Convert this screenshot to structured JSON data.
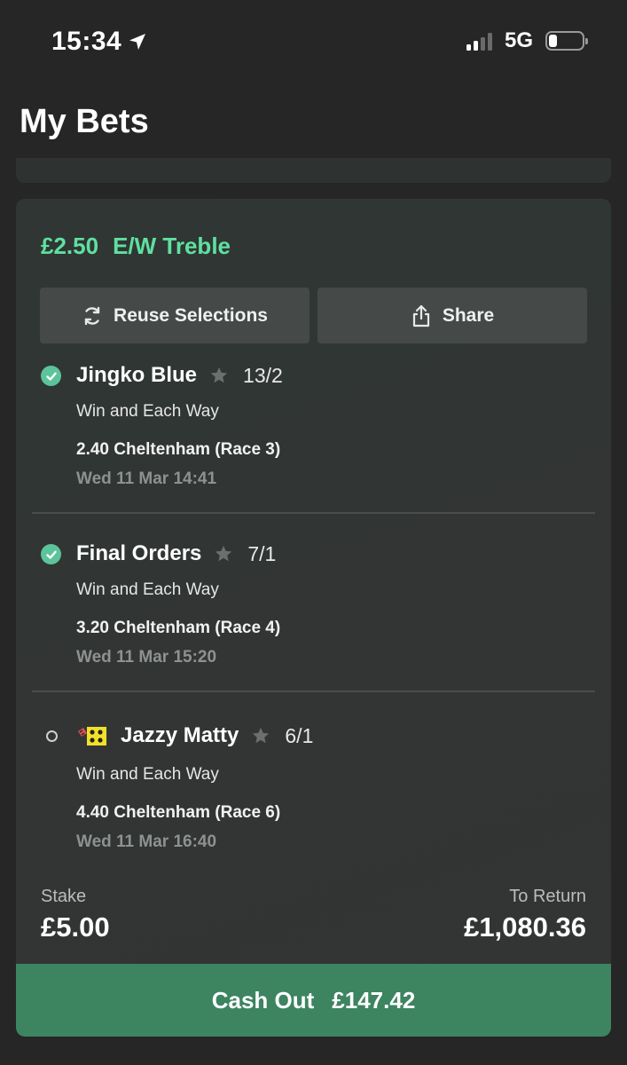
{
  "status_bar": {
    "time": "15:34",
    "network": "5G"
  },
  "header": {
    "title": "My Bets"
  },
  "bet": {
    "stake_amount": "£2.50",
    "bet_name": "E/W Treble",
    "reuse_label": "Reuse Selections",
    "share_label": "Share",
    "selections": [
      {
        "name": "Jingko Blue",
        "odds": "13/2",
        "bet_type": "Win and Each Way",
        "race": "2.40 Cheltenham (Race 3)",
        "datetime": "Wed 11 Mar 14:41",
        "status": "settled"
      },
      {
        "name": "Final Orders",
        "odds": "7/1",
        "bet_type": "Win and Each Way",
        "race": "3.20 Cheltenham (Race 4)",
        "datetime": "Wed 11 Mar 15:20",
        "status": "settled"
      },
      {
        "name": "Jazzy Matty",
        "odds": "6/1",
        "bet_type": "Win and Each Way",
        "race": "4.40 Cheltenham (Race 6)",
        "datetime": "Wed 11 Mar 16:40",
        "status": "open"
      }
    ],
    "stake_label": "Stake",
    "stake_value": "£5.00",
    "return_label": "To Return",
    "return_value": "£1,080.36",
    "cashout_label": "Cash Out",
    "cashout_value": "£147.42"
  },
  "colors": {
    "accent": "#5fe0a0",
    "cashout": "#3d8461",
    "check": "#5cc49a"
  }
}
